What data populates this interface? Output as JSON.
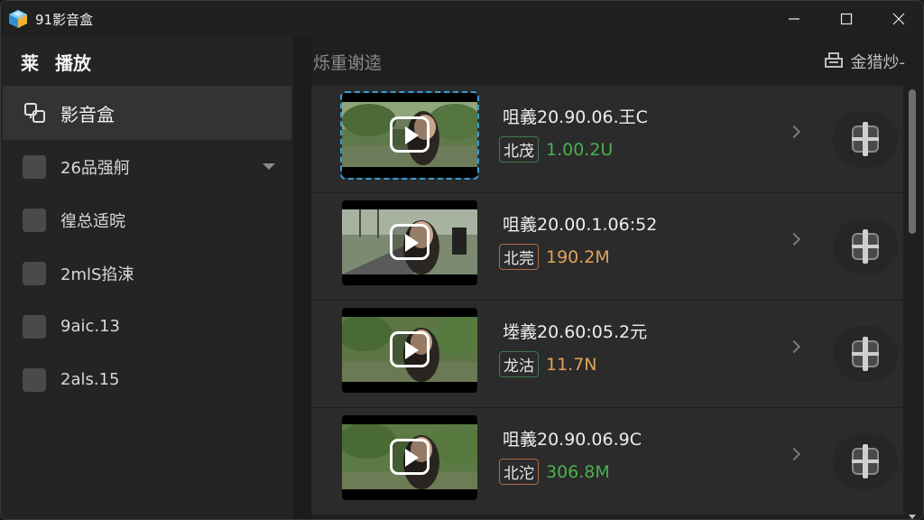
{
  "app": {
    "title": "91影音盒",
    "logo_icon": "app-logo-icon"
  },
  "window_controls": {
    "minimize": "minimize-icon",
    "maximize": "maximize-icon",
    "close": "close-icon"
  },
  "sidebar": {
    "header": [
      "莱",
      "播放"
    ],
    "main_item": {
      "label": "影音盒",
      "icon": "media-box-icon"
    },
    "items": [
      {
        "label": "26品强舸",
        "has_dropdown": true
      },
      {
        "label": "徨总适晥"
      },
      {
        "label": "2mlS掐涑"
      },
      {
        "label": "9aic.13"
      },
      {
        "label": "2als.15"
      }
    ]
  },
  "main": {
    "title": "烁重谢逵",
    "action_label": "金猎炒-",
    "action_icon": "export-icon"
  },
  "videos": [
    {
      "name": "咀義20.90.06.王C",
      "tag": "北茂",
      "tag_color": "#3f7a4e",
      "size": "1.00.2U",
      "size_color": "#4caf50",
      "selected": true
    },
    {
      "name": "咀義20.00.1.06:52",
      "tag": "北莞",
      "tag_color": "#b06a45",
      "size": "190.2M",
      "size_color": "#e0a35a",
      "selected": false
    },
    {
      "name": "堘義20.60:05.2元",
      "tag": "龙沽",
      "tag_color": "#3f7a4e",
      "size": "11.7N",
      "size_color": "#e0a35a",
      "selected": false
    },
    {
      "name": "咀義20.90.06.9C",
      "tag": "北沱",
      "tag_color": "#b06a45",
      "size": "306.8M",
      "size_color": "#4caf50",
      "selected": false
    }
  ],
  "colors": {
    "accent_selected": "#3a9bd5",
    "background": "#202020",
    "row": "#2b2b2b"
  }
}
